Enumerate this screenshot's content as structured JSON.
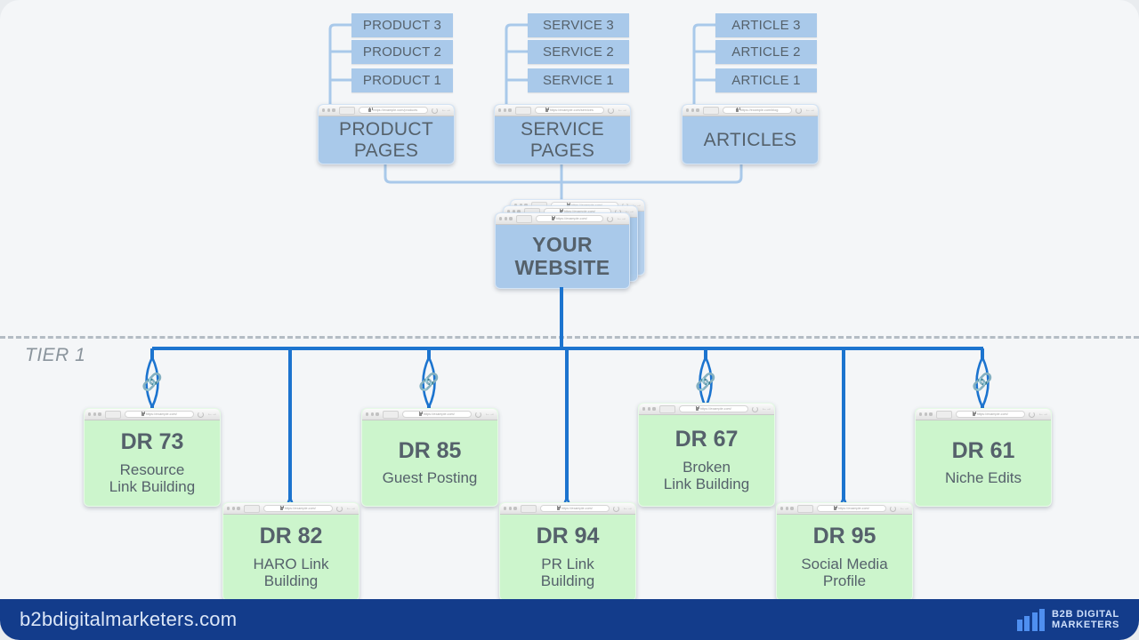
{
  "colors": {
    "page_bg": "#f4f6f8",
    "blue_box": "#a9c9ea",
    "green_box": "#ccf5cc",
    "text_slate": "#55616b",
    "connector_light_blue": "#a9c9ea",
    "connector_blue": "#1c74cf",
    "link_icon_cyan": "#26d7f7",
    "dash_gray": "#b4bcc4",
    "footer_navy": "#133c8b",
    "logo_bar_blue": "#4f8ff0"
  },
  "top_columns": [
    {
      "name": "product",
      "parent_label_line1": "PRODUCT",
      "parent_label_line2": "PAGES",
      "parent_url": "https://example.com/products",
      "children": [
        "PRODUCT 3",
        "PRODUCT 2",
        "PRODUCT 1"
      ]
    },
    {
      "name": "service",
      "parent_label_line1": "SERVICE",
      "parent_label_line2": "PAGES",
      "parent_url": "https://example.com/services",
      "children": [
        "SERVICE 3",
        "SERVICE 2",
        "SERVICE 1"
      ]
    },
    {
      "name": "articles",
      "parent_label_line1": "ARTICLES",
      "parent_label_line2": "",
      "parent_url": "https://example.com/blog",
      "children": [
        "ARTICLE 3",
        "ARTICLE 2",
        "ARTICLE 1"
      ]
    }
  ],
  "website": {
    "label_line1": "YOUR",
    "label_line2": "WEBSITE",
    "url": "https://example.com/"
  },
  "tier": {
    "label": "TIER 1"
  },
  "backlinks": [
    {
      "dr": "DR 73",
      "name_line1": "Resource",
      "name_line2": "Link Building",
      "url": "https://example.com/"
    },
    {
      "dr": "DR 82",
      "name_line1": "HARO Link",
      "name_line2": "Building",
      "url": "https://example.com/"
    },
    {
      "dr": "DR 85",
      "name_line1": "Guest Posting",
      "name_line2": "",
      "url": "https://example.com/"
    },
    {
      "dr": "DR 94",
      "name_line1": "PR Link",
      "name_line2": "Building",
      "url": "https://example.com/"
    },
    {
      "dr": "DR 67",
      "name_line1": "Broken",
      "name_line2": "Link Building",
      "url": "https://example.com/"
    },
    {
      "dr": "DR 95",
      "name_line1": "Social Media",
      "name_line2": "Profile",
      "url": "https://example.com/"
    },
    {
      "dr": "DR 61",
      "name_line1": "Niche Edits",
      "name_line2": "",
      "url": "https://example.com/"
    }
  ],
  "footer": {
    "site": "b2bdigitalmarketers.com",
    "logo_line1": "B2B DIGITAL",
    "logo_line2": "MARKETERS"
  }
}
